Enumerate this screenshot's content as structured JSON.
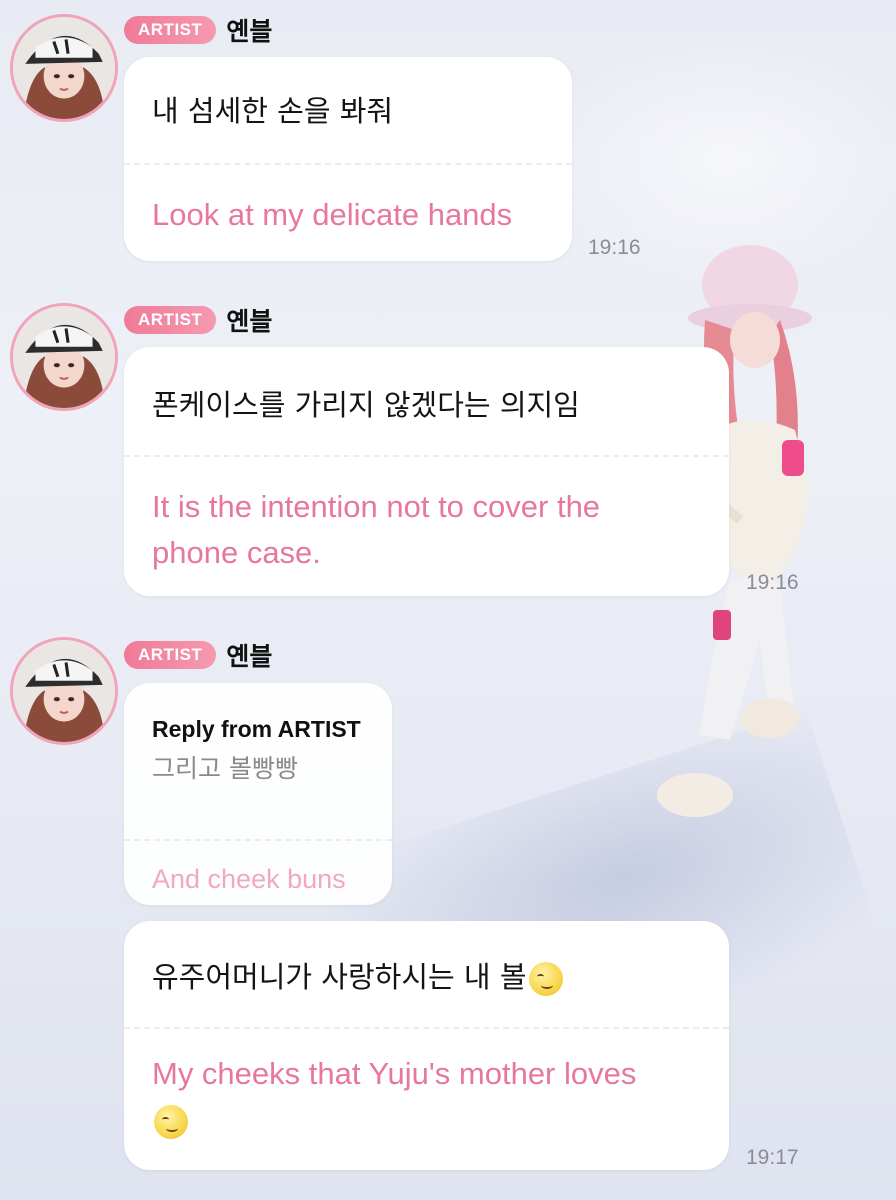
{
  "badge_label": "ARTIST",
  "sender_name": "옌블",
  "messages": [
    {
      "ko": "내 섬세한 손을 봐줘",
      "en": "Look at my delicate hands",
      "time": "19:16"
    },
    {
      "ko": "폰케이스를 가리지 않겠다는 의지임",
      "en": "It is the intention not to cover the phone case.",
      "time": "19:16"
    },
    {
      "reply_header": "Reply from ARTIST",
      "reply_ko": "그리고 볼빵빵",
      "reply_en": "And cheek buns"
    },
    {
      "ko": "유주어머니가 사랑하시는 내 볼",
      "en": "My cheeks that Yuju's mother loves",
      "emoji": "slightly-smiling-moon-face-emoji",
      "time": "19:17"
    }
  ],
  "colors": {
    "badge": "#f07a98",
    "translation_text": "#e8789a",
    "avatar_ring": "#f0a3b9"
  }
}
